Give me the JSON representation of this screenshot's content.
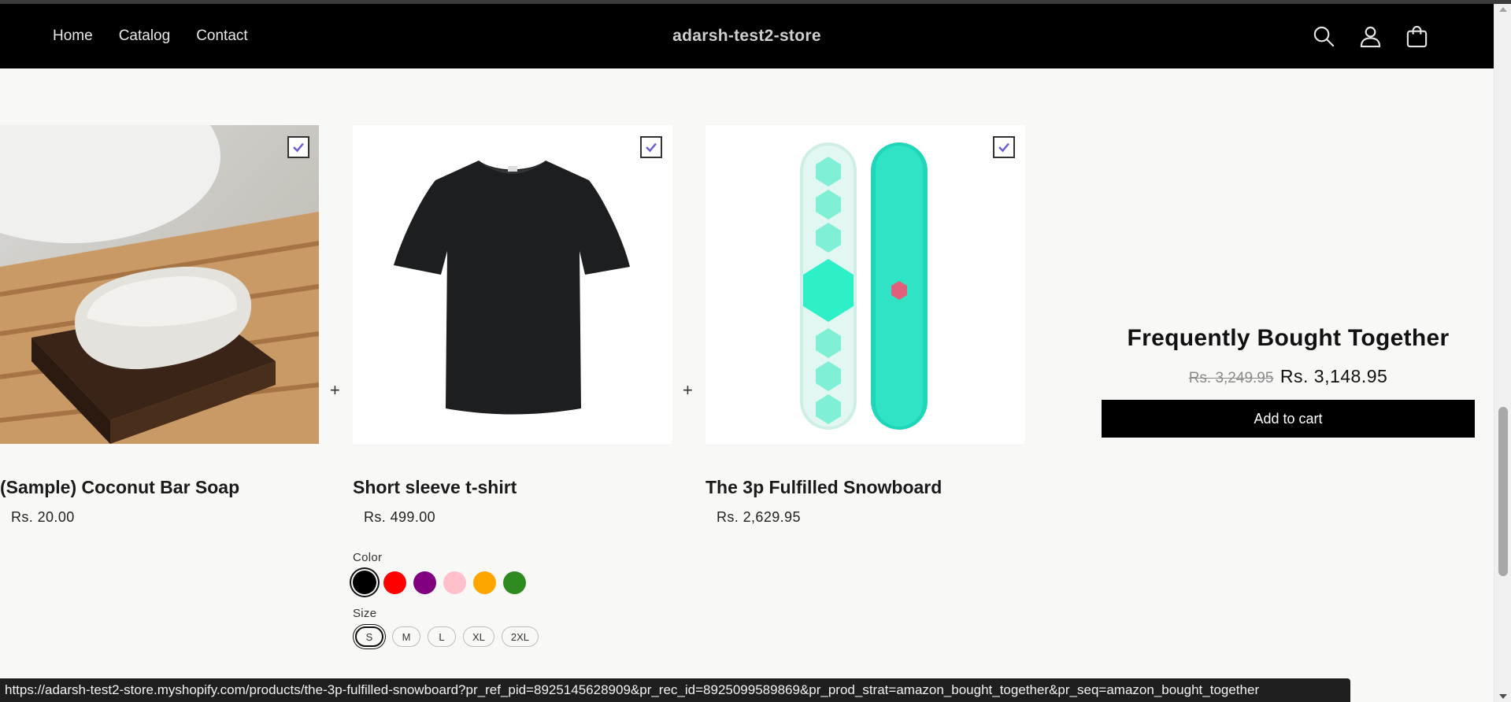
{
  "header": {
    "nav": [
      {
        "label": "Home"
      },
      {
        "label": "Catalog"
      },
      {
        "label": "Contact"
      }
    ],
    "store_name": "adarsh-test2-store",
    "icons": [
      "search-icon",
      "account-icon",
      "cart-icon"
    ]
  },
  "products": [
    {
      "title": "(Sample) Coconut Bar Soap",
      "price": "Rs. 20.00",
      "checked": true
    },
    {
      "title": "Short sleeve t-shirt",
      "price": "Rs. 499.00",
      "checked": true
    },
    {
      "title": "The 3p Fulfilled Snowboard",
      "price": "Rs. 2,629.95",
      "checked": true
    }
  ],
  "variant_options": {
    "color_label": "Color",
    "colors": [
      {
        "name": "Black",
        "hex": "#000000",
        "selected": true
      },
      {
        "name": "Red",
        "hex": "#ff0000",
        "selected": false
      },
      {
        "name": "Purple",
        "hex": "#800080",
        "selected": false
      },
      {
        "name": "Pink",
        "hex": "#ffc0cb",
        "selected": false
      },
      {
        "name": "Orange",
        "hex": "#ffa500",
        "selected": false
      },
      {
        "name": "Green",
        "hex": "#2e8b20",
        "selected": false
      }
    ],
    "size_label": "Size",
    "sizes": [
      {
        "label": "S",
        "selected": true
      },
      {
        "label": "M",
        "selected": false
      },
      {
        "label": "L",
        "selected": false
      },
      {
        "label": "XL",
        "selected": false
      },
      {
        "label": "2XL",
        "selected": false
      }
    ]
  },
  "separator": "+",
  "fbt": {
    "heading": "Frequently Bought Together",
    "original_price": "Rs. 3,249.95",
    "discounted_price": "Rs. 3,148.95",
    "button_label": "Add to cart"
  },
  "status_url": "https://adarsh-test2-store.myshopify.com/products/the-3p-fulfilled-snowboard?pr_ref_pid=8925145628909&pr_rec_id=8925099589869&pr_prod_strat=amazon_bought_together&pr_seq=amazon_bought_together",
  "colors": {
    "header_bg": "#000000",
    "page_bg": "#f8f8f6",
    "checkbox_check": "#6b5fd6",
    "button_bg": "#000000"
  }
}
